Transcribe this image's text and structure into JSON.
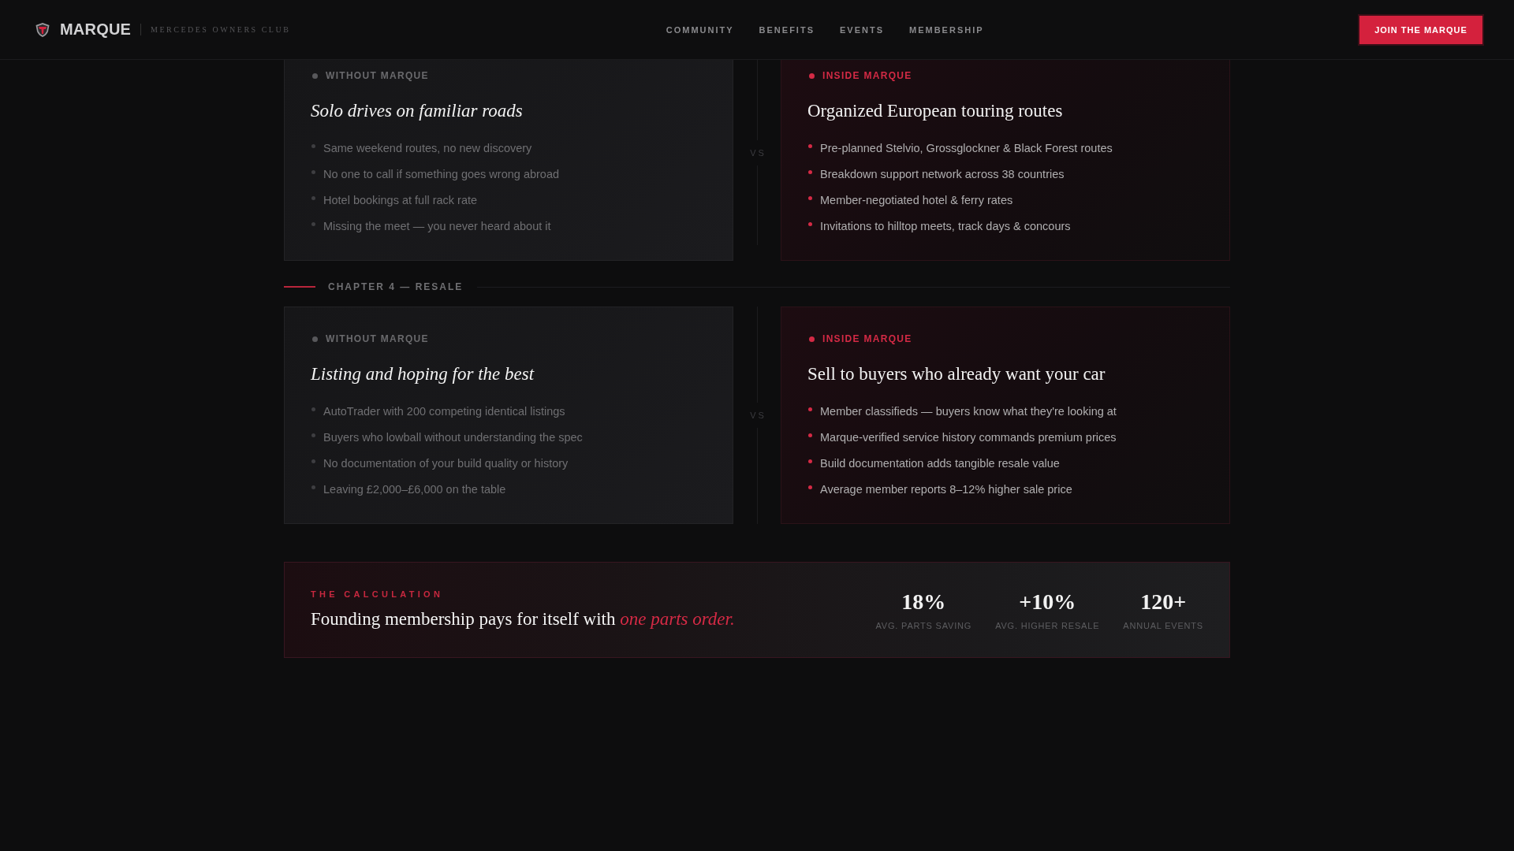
{
  "header": {
    "brand": "MARQUE",
    "tagline": "MERCEDES OWNERS CLUB",
    "nav": [
      {
        "label": "COMMUNITY"
      },
      {
        "label": "BENEFITS"
      },
      {
        "label": "EVENTS"
      },
      {
        "label": "MEMBERSHIP"
      }
    ],
    "cta": "JOIN THE MARQUE"
  },
  "comparisons": [
    {
      "left": {
        "kind": "without",
        "label": "WITHOUT MARQUE",
        "title": "Solo drives on familiar roads",
        "points": [
          "Same weekend routes, no new discovery",
          "No one to call if something goes wrong abroad",
          "Hotel bookings at full rack rate",
          "Missing the meet — you never heard about it"
        ]
      },
      "divider": "VS",
      "right": {
        "kind": "inside",
        "label": "INSIDE MARQUE",
        "title": "Organized European touring routes",
        "points": [
          "Pre-planned Stelvio, Grossglockner & Black Forest routes",
          "Breakdown support network across 38 countries",
          "Member-negotiated hotel & ferry rates",
          "Invitations to hilltop meets, track days & concours"
        ]
      }
    },
    {
      "chapter": "CHAPTER 4 — RESALE",
      "left": {
        "kind": "without",
        "label": "WITHOUT MARQUE",
        "title": "Listing and hoping for the best",
        "points": [
          "AutoTrader with 200 competing identical listings",
          "Buyers who lowball without understanding the spec",
          "No documentation of your build quality or history",
          "Leaving £2,000–£6,000 on the table"
        ]
      },
      "divider": "VS",
      "right": {
        "kind": "inside",
        "label": "INSIDE MARQUE",
        "title": "Sell to buyers who already want your car",
        "points": [
          "Member classifieds — buyers know what they're looking at",
          "Marque-verified service history commands premium prices",
          "Build documentation adds tangible resale value",
          "Average member reports 8–12% higher sale price"
        ]
      }
    }
  ],
  "calculation": {
    "eyebrow": "THE CALCULATION",
    "headline": "Founding membership pays for itself with *one parts order.*",
    "stats": [
      {
        "value": "18%",
        "label": "AVG. PARTS SAVING"
      },
      {
        "value": "+10%",
        "label": "AVG. HIGHER RESALE"
      },
      {
        "value": "120+",
        "label": "ANNUAL EVENTS"
      }
    ]
  }
}
